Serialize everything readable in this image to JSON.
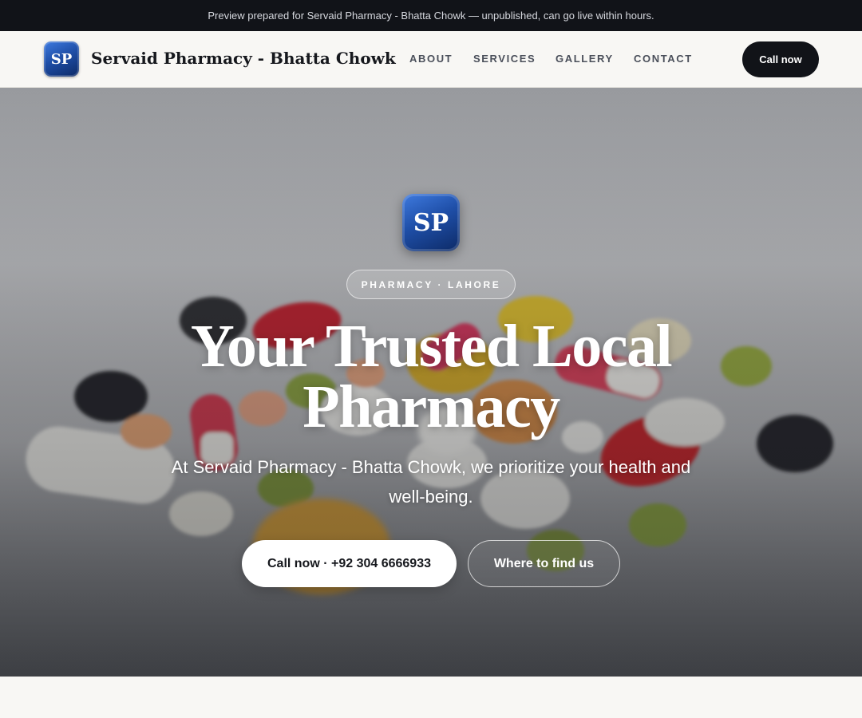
{
  "topbar": {
    "notice": "Preview prepared for Servaid Pharmacy - Bhatta Chowk — unpublished, can go live within hours."
  },
  "header": {
    "logo_initials": "SP",
    "brand_name": "Servaid Pharmacy - Bhatta Chowk",
    "nav": {
      "about": "ABOUT",
      "services": "SERVICES",
      "gallery": "GALLERY",
      "contact": "CONTACT"
    },
    "call_label": "Call now"
  },
  "hero": {
    "badge_initials": "SP",
    "eyebrow": "PHARMACY · LAHORE",
    "headline_line1": "Your Trusted Local",
    "headline_line2": "Pharmacy",
    "subline": "At Servaid Pharmacy - Bhatta Chowk, we prioritize your health and well-being.",
    "primary_cta": "Call now · +92 304 6666933",
    "secondary_cta": "Where to find us",
    "background_image": "pills-and-capsules-photo"
  },
  "colors": {
    "dark": "#111318",
    "brand_blue": "#1f4fa8",
    "page_bg": "#f8f7f4"
  }
}
